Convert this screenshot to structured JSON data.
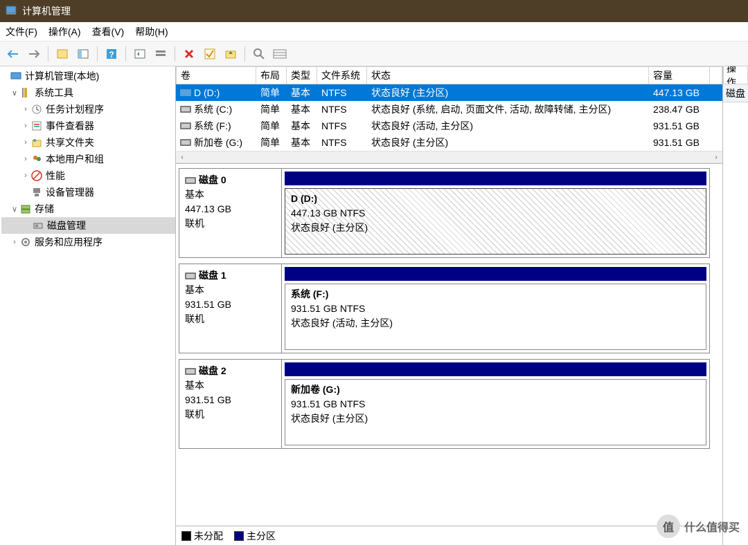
{
  "window": {
    "title": "计算机管理"
  },
  "menu": {
    "file": "文件(F)",
    "action": "操作(A)",
    "view": "查看(V)",
    "help": "帮助(H)"
  },
  "tree": {
    "root": "计算机管理(本地)",
    "systools": "系统工具",
    "task": "任务计划程序",
    "event": "事件查看器",
    "shared": "共享文件夹",
    "users": "本地用户和组",
    "perf": "性能",
    "devmgr": "设备管理器",
    "storage": "存储",
    "diskmgmt": "磁盘管理",
    "services": "服务和应用程序"
  },
  "volcols": {
    "vol": "卷",
    "layout": "布局",
    "type": "类型",
    "fs": "文件系统",
    "status": "状态",
    "cap": "容量"
  },
  "volumes": [
    {
      "name": "D (D:)",
      "layout": "简单",
      "type": "基本",
      "fs": "NTFS",
      "status": "状态良好 (主分区)",
      "cap": "447.13 GB",
      "icon": "ssd",
      "selected": true
    },
    {
      "name": "系统 (C:)",
      "layout": "简单",
      "type": "基本",
      "fs": "NTFS",
      "status": "状态良好 (系统, 启动, 页面文件, 活动, 故障转储, 主分区)",
      "cap": "238.47 GB",
      "icon": "hdd",
      "selected": false
    },
    {
      "name": "系统 (F:)",
      "layout": "简单",
      "type": "基本",
      "fs": "NTFS",
      "status": "状态良好 (活动, 主分区)",
      "cap": "931.51 GB",
      "icon": "hdd",
      "selected": false
    },
    {
      "name": "新加卷 (G:)",
      "layout": "简单",
      "type": "基本",
      "fs": "NTFS",
      "status": "状态良好 (主分区)",
      "cap": "931.51 GB",
      "icon": "hdd",
      "selected": false
    }
  ],
  "disks": [
    {
      "title": "磁盘 0",
      "type": "基本",
      "size": "447.13 GB",
      "state": "联机",
      "part": {
        "title": "D  (D:)",
        "size": "447.13 GB NTFS",
        "status": "状态良好 (主分区)",
        "selected": true
      }
    },
    {
      "title": "磁盘 1",
      "type": "基本",
      "size": "931.51 GB",
      "state": "联机",
      "part": {
        "title": "系统  (F:)",
        "size": "931.51 GB NTFS",
        "status": "状态良好 (活动, 主分区)",
        "selected": false
      }
    },
    {
      "title": "磁盘 2",
      "type": "基本",
      "size": "931.51 GB",
      "state": "联机",
      "part": {
        "title": "新加卷  (G:)",
        "size": "931.51 GB NTFS",
        "status": "状态良好 (主分区)",
        "selected": false
      }
    }
  ],
  "legend": {
    "unalloc": "未分配",
    "primary": "主分区"
  },
  "right": {
    "header": "操作",
    "item": "磁盘"
  },
  "watermark": "什么值得买"
}
